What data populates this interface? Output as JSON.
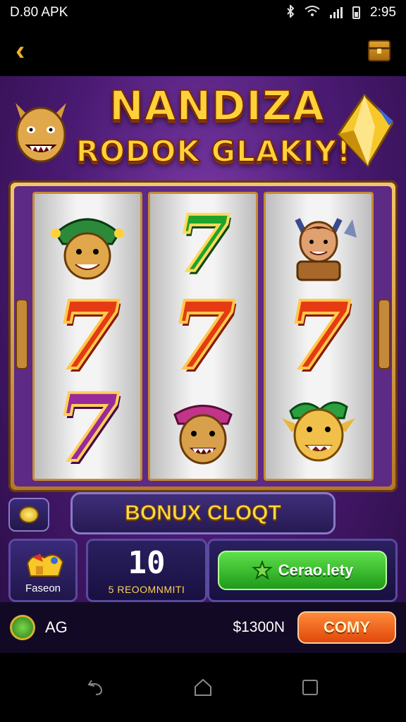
{
  "status_bar": {
    "left_text": "D.80 APK",
    "time": "2:95",
    "icons": [
      "bluetooth-icon",
      "wifi-icon",
      "signal-icon",
      "battery-icon"
    ]
  },
  "top_bar": {
    "back_icon": "chevron-left-icon",
    "right_icon": "treasure-chest-icon"
  },
  "game": {
    "title_line1": "NANDIZA",
    "title_line2": "RODOK GLAKIY!",
    "reels": [
      [
        "goblin-jester",
        "7",
        "7"
      ],
      [
        "7",
        "7",
        "pirate-face"
      ],
      [
        "horned-warrior",
        "7",
        "gold-goblin"
      ]
    ],
    "reel_colors": [
      [
        "",
        "red",
        "purple"
      ],
      [
        "green",
        "red",
        ""
      ],
      [
        "",
        "red",
        ""
      ]
    ],
    "bonus_label": "BONUX CLOQT",
    "feature_label": "Faseon",
    "count_value": "10",
    "count_label": "5 REOOMNMITI",
    "spin_label": "Cerao.lety",
    "region": "AG",
    "balance": "$1300N",
    "copy_label": "COMY"
  },
  "colors": {
    "background": "#4a1a72",
    "accent_gold": "#ffd23a",
    "spin_green": "#1f9a1a",
    "copy_orange": "#e0480a"
  }
}
